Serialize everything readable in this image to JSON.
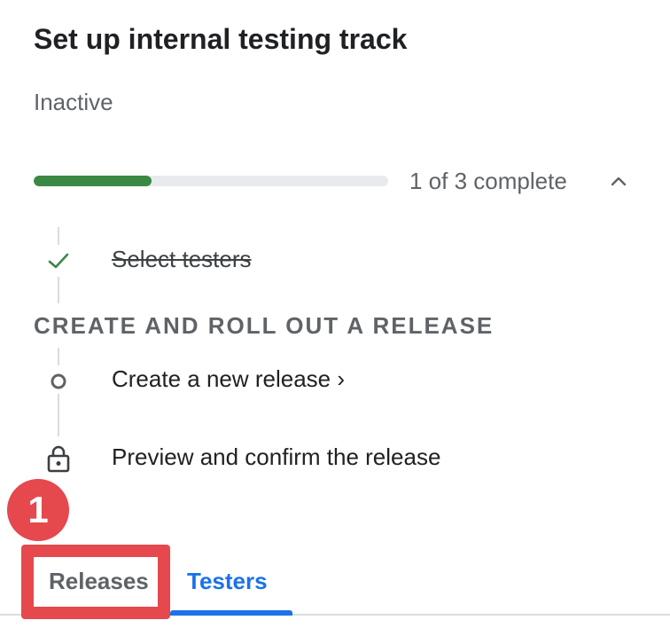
{
  "header": {
    "title": "Set up internal testing track",
    "status": "Inactive"
  },
  "progress": {
    "completed": 1,
    "total": 3,
    "label": "1 of 3 complete",
    "collapse_icon": "chevron-up-icon"
  },
  "steps": {
    "select_testers": {
      "label": "Select testers",
      "state": "complete",
      "icon": "check-icon"
    },
    "section_heading": "CREATE AND ROLL OUT A RELEASE",
    "create_release": {
      "label": "Create a new release ›",
      "state": "current",
      "icon": "circle-icon"
    },
    "preview_release": {
      "label": "Preview and confirm the release",
      "state": "locked",
      "icon": "lock-icon"
    }
  },
  "tabs": [
    {
      "label": "Releases",
      "selected": false
    },
    {
      "label": "Testers",
      "selected": true
    }
  ],
  "annotation": {
    "number": "1"
  },
  "colors": {
    "accent": "#1a73e8",
    "progress": "#3b8845",
    "annotation": "#e5484d"
  }
}
